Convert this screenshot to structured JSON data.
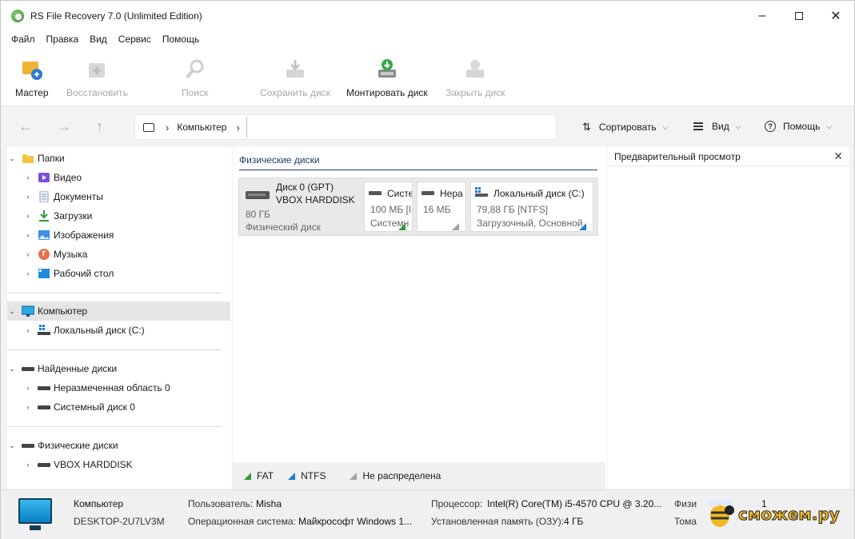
{
  "window": {
    "title": "RS File Recovery 7.0 (Unlimited Edition)"
  },
  "menu": [
    "Файл",
    "Правка",
    "Вид",
    "Сервис",
    "Помощь"
  ],
  "toolbar": {
    "wizard": "Мастер",
    "restore": "Восстановить",
    "search": "Поиск",
    "save_disk": "Сохранить диск",
    "mount_disk": "Монтировать диск",
    "close_disk": "Закрыть диск"
  },
  "nav": {
    "path": "Компьютер",
    "sort": "Сортировать",
    "view": "Вид",
    "help": "Помощь"
  },
  "tree": {
    "folders": "Папки",
    "video": "Видео",
    "documents": "Документы",
    "downloads": "Загрузки",
    "images": "Изображения",
    "music": "Музыка",
    "desktop": "Рабочий стол",
    "computer": "Компьютер",
    "local_disk": "Локальный диск (C:)",
    "found_disks": "Найденные диски",
    "unallocated": "Неразмеченная область 0",
    "system_disk": "Системный диск 0",
    "physical_disks": "Физические диски",
    "vbox": "VBOX HARDDISK"
  },
  "center": {
    "header": "Физические диски",
    "disk": {
      "name": "Диск 0 (GPT)",
      "model": "VBOX HARDDISK",
      "size": "80 ГБ",
      "type": "Физический диск"
    },
    "partitions": [
      {
        "name": "Систе",
        "size": "100 МБ [I",
        "type": "Системн"
      },
      {
        "name": "Нера",
        "size": "16 МБ",
        "type": ""
      },
      {
        "name": "Локальный диск (C:)",
        "size": "79,88 ГБ [NTFS]",
        "type": "Загрузочный, Основной"
      }
    ],
    "legend": {
      "fat": "FAT",
      "ntfs": "NTFS",
      "unalloc": "Не распределена"
    }
  },
  "preview": {
    "title": "Предварительный просмотр"
  },
  "status": {
    "computer_label": "Компьютер",
    "computer_name": "DESKTOP-2U7LV3M",
    "user_label": "Пользователь:",
    "user_value": "Misha",
    "os_label": "Операционная система:",
    "os_value": "Майкрософт Windows 1...",
    "cpu_label": "Процессор:",
    "cpu_value": "Intel(R) Core(TM) i5-4570 CPU @ 3.20...",
    "ram_label": "Установленная память (ОЗУ):",
    "ram_value": "4 ГБ",
    "phys_label": "Физи",
    "phys_value": "1",
    "vol_label": "Тома"
  },
  "watermark": "сможем.ру",
  "colors": {
    "fat": "#2e9a3a",
    "ntfs": "#1c7ad6",
    "unalloc": "#a0a0a0",
    "header": "#1e3c6e"
  }
}
